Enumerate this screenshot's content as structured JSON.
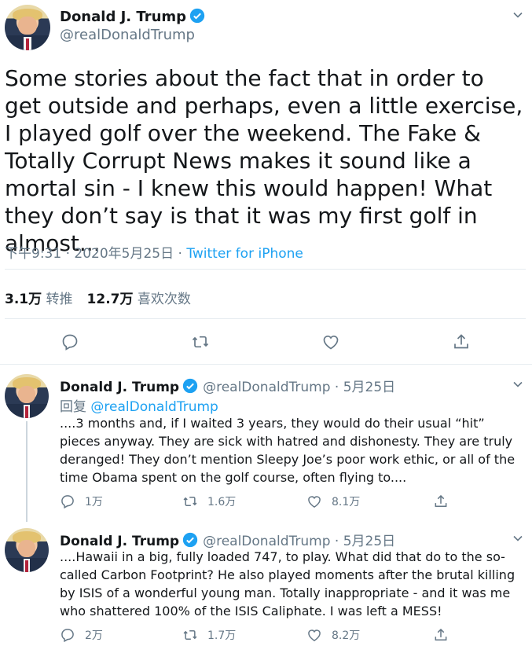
{
  "main_tweet": {
    "name": "Donald J. Trump",
    "handle": "@realDonaldTrump",
    "text": "Some stories about the fact that in order to get outside and perhaps, even a little exercise, I played golf over the weekend. The Fake & Totally Corrupt News makes it sound like a mortal sin - I knew this would happen! What they don’t say is that it was my first golf in almost...",
    "time": "下午9:31 · 2020年5月25日 · ",
    "source": "Twitter for iPhone",
    "retweets_count": "3.1万",
    "retweets_label": "转推",
    "likes_count": "12.7万",
    "likes_label": "喜欢次数"
  },
  "replies": [
    {
      "name": "Donald J. Trump",
      "handle": "@realDonaldTrump · 5月25日",
      "reply_prefix": "回复 ",
      "reply_to": "@realDonaldTrump",
      "text": "....3 months and, if I waited 3 years, they would do their usual “hit” pieces anyway. They are sick with hatred and dishonesty. They are truly deranged! They don’t mention Sleepy Joe’s poor work ethic, or all of the time Obama spent on the golf course, often flying to....",
      "replies": "1万",
      "retweets": "1.6万",
      "likes": "8.1万"
    },
    {
      "name": "Donald J. Trump",
      "handle": "@realDonaldTrump · 5月25日",
      "text": "....Hawaii in a big, fully loaded 747, to play. What did that do to the so-called Carbon Footprint? He also played moments after the brutal killing by ISIS of a wonderful young man. Totally inappropriate - and it was me who shattered 100% of the ISIS Caliphate. I was left a MESS!",
      "replies": "2万",
      "retweets": "1.7万",
      "likes": "8.2万"
    }
  ],
  "colors": {
    "accent": "#1da1f2",
    "secondary": "#657786",
    "border": "#e6ecf0"
  }
}
